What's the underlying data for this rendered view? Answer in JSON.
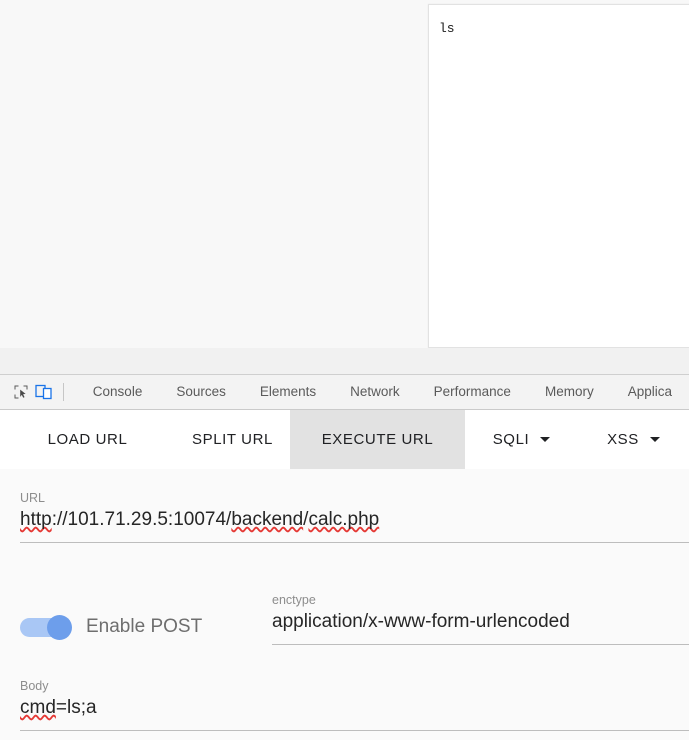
{
  "page": {
    "output_panel": {
      "name": "command-output-panel",
      "text": "ls"
    }
  },
  "devtools": {
    "icons": [
      {
        "name": "inspect-element-icon",
        "label": "inspect-element"
      },
      {
        "name": "device-toolbar-icon",
        "label": "device-toolbar"
      }
    ],
    "tabs": [
      {
        "label": "Console"
      },
      {
        "label": "Sources"
      },
      {
        "label": "Elements"
      },
      {
        "label": "Network"
      },
      {
        "label": "Performance"
      },
      {
        "label": "Memory"
      },
      {
        "label": "Applica"
      }
    ]
  },
  "hackbar": {
    "tabs": [
      {
        "label": "LOAD URL",
        "active": false,
        "dropdown": false
      },
      {
        "label": "SPLIT URL",
        "active": false,
        "dropdown": false
      },
      {
        "label": "EXECUTE URL",
        "active": true,
        "dropdown": false
      },
      {
        "label": "SQLI",
        "active": false,
        "dropdown": true
      },
      {
        "label": "XSS",
        "active": false,
        "dropdown": true
      }
    ],
    "url": {
      "label": "URL",
      "value": "http://101.71.29.5:10074/backend/calc.php",
      "parts": [
        {
          "text": "http",
          "misspelled": true
        },
        {
          "text": "://101.71.29.5:10074/",
          "misspelled": false
        },
        {
          "text": "backend",
          "misspelled": true
        },
        {
          "text": "/",
          "misspelled": false
        },
        {
          "text": "calc.php",
          "misspelled": true
        }
      ]
    },
    "post": {
      "label": "Enable POST",
      "enabled": true
    },
    "enctype": {
      "label": "enctype",
      "value": "application/x-www-form-urlencoded"
    },
    "body": {
      "label": "Body",
      "value": "cmd=ls;a",
      "parts": [
        {
          "text": "cmd",
          "misspelled": true
        },
        {
          "text": "=ls;a",
          "misspelled": false
        }
      ]
    }
  },
  "colors": {
    "accent_blue": "#6d9eeb",
    "toggle_track": "#a9c7f5",
    "active_tab_bg": "#e2e2e2",
    "spellcheck_red": "#e53935",
    "page_bg": "#f8f8f8"
  }
}
